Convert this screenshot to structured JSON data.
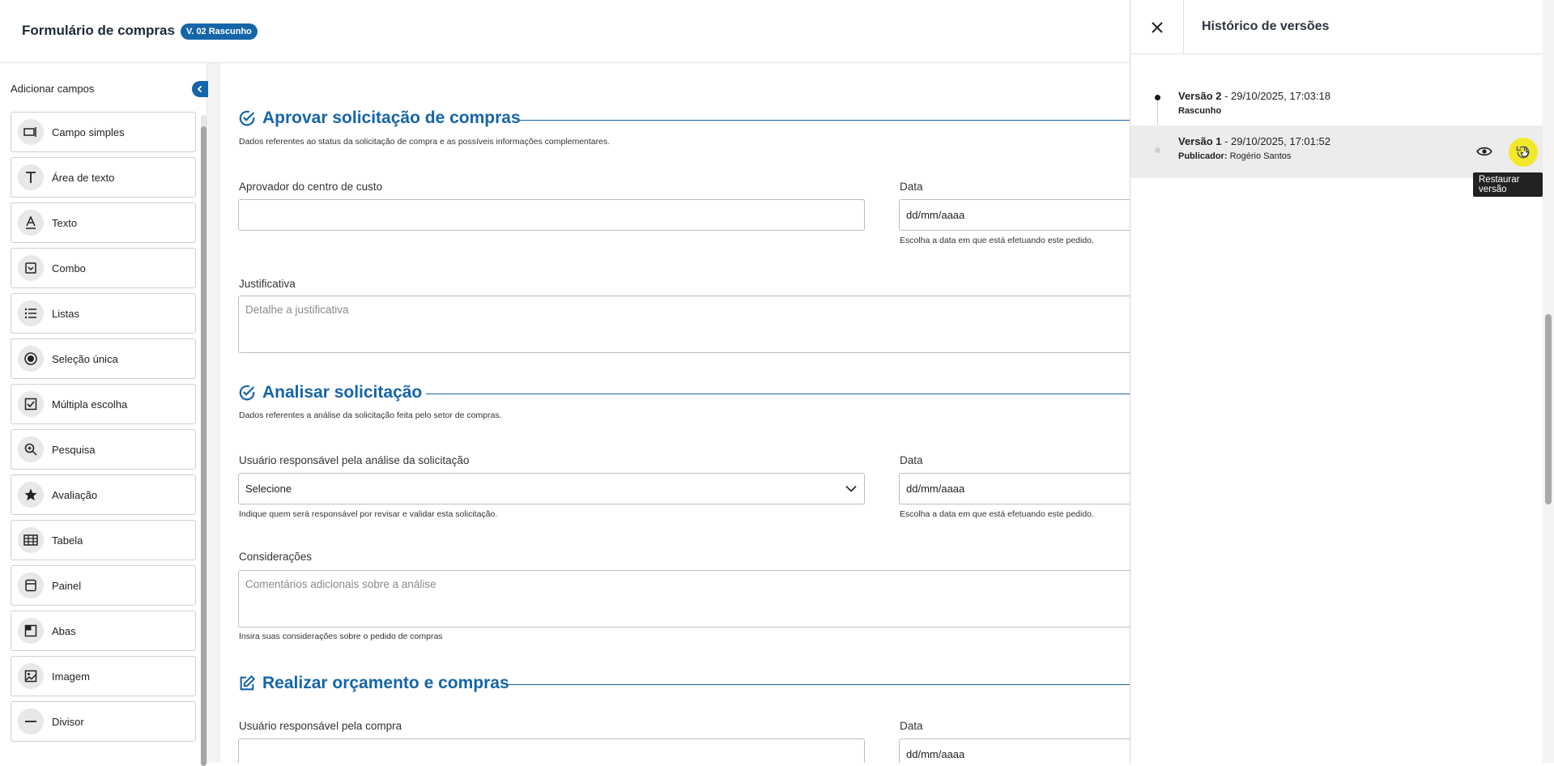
{
  "header": {
    "title": "Formulário de compras",
    "version_badge": "V. 02 Rascunho"
  },
  "sidebar": {
    "heading": "Adicionar campos",
    "collapse_icon": "chevron-left-icon",
    "items": [
      {
        "label": "Campo simples",
        "icon": "input-field-icon"
      },
      {
        "label": "Área de texto",
        "icon": "text-area-icon"
      },
      {
        "label": "Texto",
        "icon": "text-icon"
      },
      {
        "label": "Combo",
        "icon": "combo-icon"
      },
      {
        "label": "Listas",
        "icon": "list-icon"
      },
      {
        "label": "Seleção única",
        "icon": "radio-icon"
      },
      {
        "label": "Múltipla escolha",
        "icon": "checkbox-icon"
      },
      {
        "label": "Pesquisa",
        "icon": "search-icon"
      },
      {
        "label": "Avaliação",
        "icon": "star-icon"
      },
      {
        "label": "Tabela",
        "icon": "table-icon"
      },
      {
        "label": "Painel",
        "icon": "panel-icon"
      },
      {
        "label": "Abas",
        "icon": "tabs-icon"
      },
      {
        "label": "Imagem",
        "icon": "image-icon"
      },
      {
        "label": "Divisor",
        "icon": "divider-icon"
      }
    ]
  },
  "form": {
    "section1": {
      "title": "Aprovar solicitação de compras",
      "description": "Dados referentes ao status da solicitação de compra e as possíveis informações complementares.",
      "approver_label": "Aprovador do centro de custo",
      "approver_value": "",
      "date_label": "Data",
      "date_placeholder": "dd/mm/aaaa",
      "date_help": "Escolha a data em que está efetuando este pedido.",
      "justification_label": "Justificativa",
      "justification_placeholder": "Detalhe a justificativa"
    },
    "section2": {
      "title": "Analisar solicitação",
      "description": "Dados referentes a análise da solicitação feita pelo setor de compras.",
      "user_label": "Usuário responsável pela análise da solicitação",
      "user_select": "Selecione",
      "user_help": "Indique quem será responsável por revisar e validar esta solicitação.",
      "date_label": "Data",
      "date_placeholder": "dd/mm/aaaa",
      "date_help": "Escolha a data em que está efetuando este pedido.",
      "considerations_label": "Considerações",
      "considerations_placeholder": "Comentários adicionais sobre a análise",
      "considerations_help": "Insira suas considerações sobre o pedido de compras"
    },
    "section3": {
      "title": "Realizar orçamento e compras",
      "user_label": "Usuário responsável pela compra",
      "date_label": "Data",
      "date_placeholder": "dd/mm/aaaa"
    }
  },
  "history": {
    "title": "Histórico de versões",
    "versions": [
      {
        "name": "Versão 2",
        "datetime": " - 29/10/2025, 17:03:18",
        "status": "Rascunho"
      },
      {
        "name": "Versão 1",
        "datetime": " - 29/10/2025, 17:01:52",
        "publisher_label": "Publicador:",
        "publisher": " Rogério Santos"
      }
    ],
    "tooltip": "Restaurar versão"
  },
  "colors": {
    "brand": "#1565a8",
    "highlight": "#f3e92b"
  }
}
